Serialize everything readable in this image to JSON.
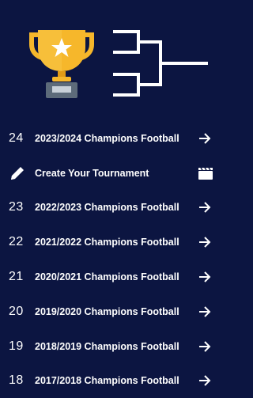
{
  "hero": {
    "trophy_icon": "trophy-icon",
    "bracket_icon": "tournament-bracket-icon"
  },
  "create_row": {
    "label": "Create Your Tournament",
    "leading_icon": "pencil-icon",
    "trailing_icon": "clapperboard-icon"
  },
  "rows": [
    {
      "number": "24",
      "label": "2023/2024 Champions Football"
    },
    {
      "number": "23",
      "label": "2022/2023 Champions Football"
    },
    {
      "number": "22",
      "label": "2021/2022 Champions Football"
    },
    {
      "number": "21",
      "label": "2020/2021 Champions Football"
    },
    {
      "number": "20",
      "label": "2019/2020 Champions Football"
    },
    {
      "number": "19",
      "label": "2018/2019 Champions Football"
    },
    {
      "number": "18",
      "label": "2017/2018 Champions Football"
    }
  ],
  "colors": {
    "background": "#0c1541",
    "trophy_gold": "#f6b72b",
    "trophy_base": "#5d6b7a",
    "text": "#ffffff"
  }
}
